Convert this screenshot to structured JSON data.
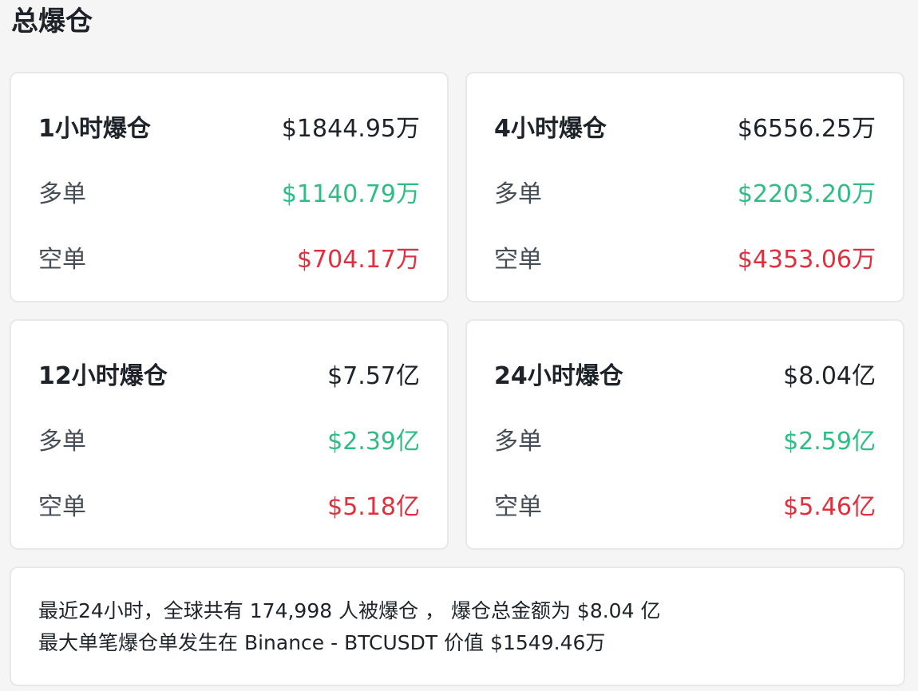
{
  "title": "总爆仓",
  "cards": [
    {
      "header_label": "1小时爆仓",
      "header_value": "$1844.95万",
      "long_label": "多单",
      "long_value": "$1140.79万",
      "short_label": "空单",
      "short_value": "$704.17万"
    },
    {
      "header_label": "4小时爆仓",
      "header_value": "$6556.25万",
      "long_label": "多单",
      "long_value": "$2203.20万",
      "short_label": "空单",
      "short_value": "$4353.06万"
    },
    {
      "header_label": "12小时爆仓",
      "header_value": "$7.57亿",
      "long_label": "多单",
      "long_value": "$2.39亿",
      "short_label": "空单",
      "short_value": "$5.18亿"
    },
    {
      "header_label": "24小时爆仓",
      "header_value": "$8.04亿",
      "long_label": "多单",
      "long_value": "$2.59亿",
      "short_label": "空单",
      "short_value": "$5.46亿"
    }
  ],
  "summary": {
    "line_1": "最近24小时，全球共有 174,998 人被爆仓 ，  爆仓总金额为 $8.04 亿",
    "line_2": "最大单笔爆仓单发生在 Binance - BTCUSDT 价值 $1549.46万"
  },
  "colors": {
    "long": "#2ebd85",
    "short": "#e0303d",
    "text": "#1e2329",
    "label": "#474d57",
    "card_bg": "#ffffff",
    "page_bg": "#f5f5f5"
  }
}
